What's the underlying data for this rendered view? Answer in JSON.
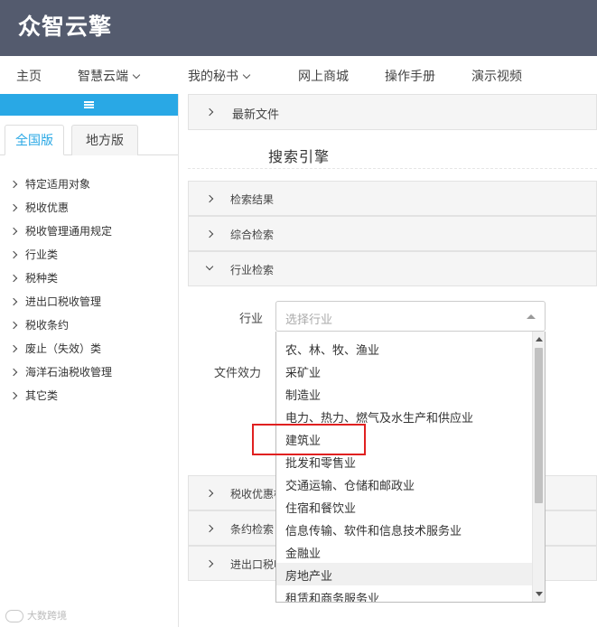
{
  "app": {
    "logo": "众智云擎"
  },
  "nav": {
    "items": [
      {
        "label": "主页",
        "dropdown": false
      },
      {
        "label": "智慧云端",
        "dropdown": true
      },
      {
        "label": "我的秘书",
        "dropdown": true
      },
      {
        "label": "网上商城",
        "dropdown": false
      },
      {
        "label": "操作手册",
        "dropdown": false
      },
      {
        "label": "演示视频",
        "dropdown": false
      }
    ]
  },
  "sidebar": {
    "tabs": [
      {
        "label": "全国版",
        "active": true
      },
      {
        "label": "地方版",
        "active": false
      }
    ],
    "items": [
      {
        "label": "特定适用对象"
      },
      {
        "label": "税收优惠"
      },
      {
        "label": "税收管理通用规定"
      },
      {
        "label": "行业类"
      },
      {
        "label": "税种类"
      },
      {
        "label": "进出口税收管理"
      },
      {
        "label": "税收条约"
      },
      {
        "label": "废止（失效）类"
      },
      {
        "label": "海洋石油税收管理"
      },
      {
        "label": "其它类"
      }
    ]
  },
  "main": {
    "latest_files": "最新文件",
    "search_title": "搜索引擎",
    "panels_top": [
      {
        "label": "检索结果",
        "expanded": false
      },
      {
        "label": "综合检索",
        "expanded": false
      },
      {
        "label": "行业检索",
        "expanded": true
      }
    ],
    "panels_bottom": [
      {
        "label": "税收优惠检"
      },
      {
        "label": "条约检索"
      },
      {
        "label": "进出口税收"
      }
    ],
    "form": {
      "industry_label": "行业",
      "effect_label": "文件效力",
      "industry_placeholder": "选择行业"
    },
    "industry_options": [
      "农、林、牧、渔业",
      "采矿业",
      "制造业",
      "电力、热力、燃气及水生产和供应业",
      "建筑业",
      "批发和零售业",
      "交通运输、仓储和邮政业",
      "住宿和餐饮业",
      "信息传输、软件和信息技术服务业",
      "金融业",
      "房地产业",
      "租赁和商务服务业"
    ],
    "highlighted_option": "房地产业",
    "marked_option": "建筑业"
  },
  "watermark": "大数跨境",
  "colors": {
    "header_bg": "#545b6e",
    "accent": "#29a8e5",
    "marker": "#e02020"
  }
}
